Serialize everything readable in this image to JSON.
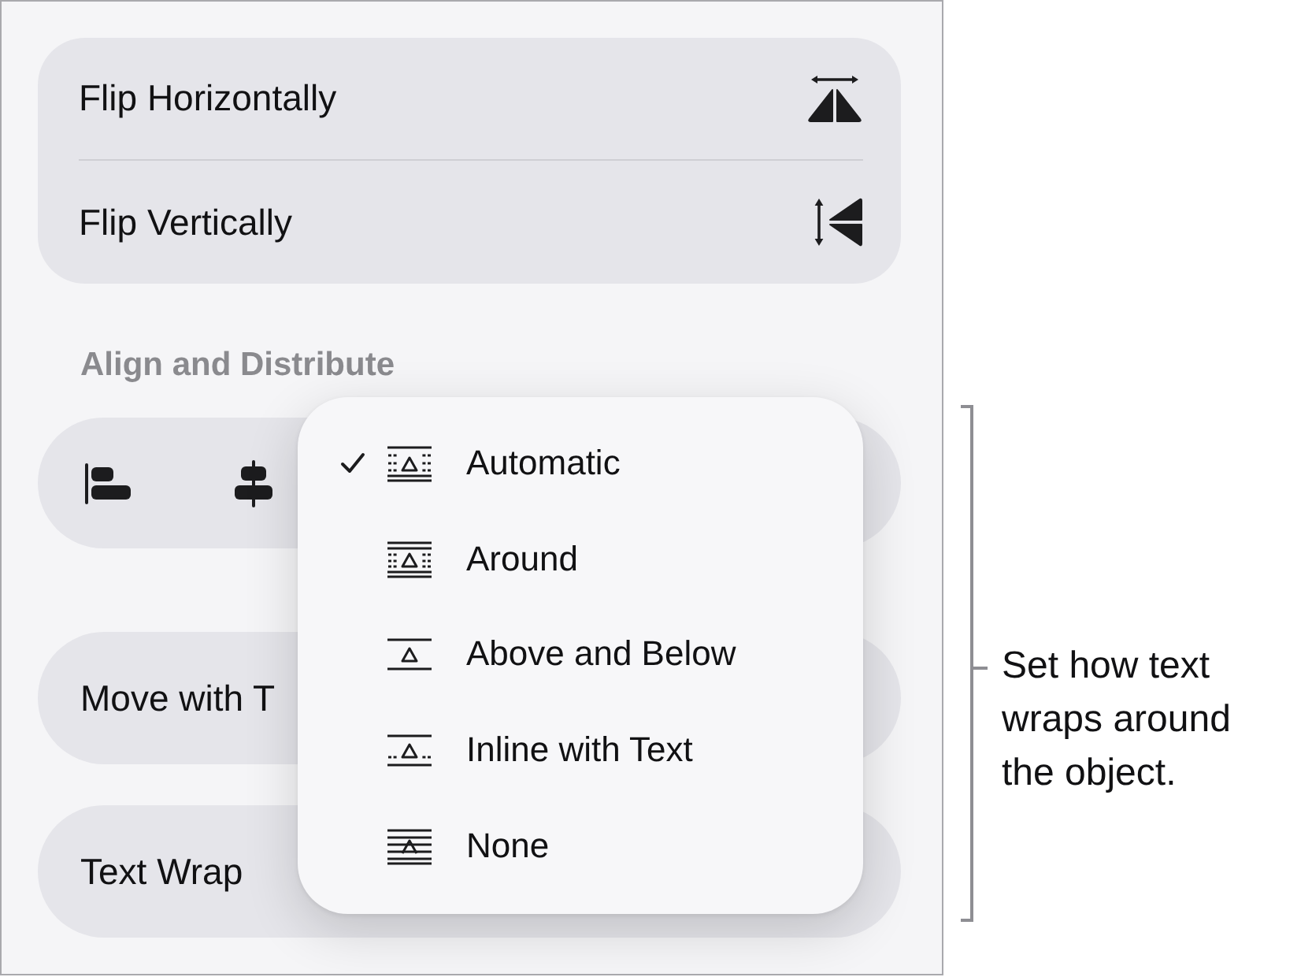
{
  "flip_options": [
    {
      "label": "Flip Horizontally"
    },
    {
      "label": "Flip Vertically"
    }
  ],
  "align_section": {
    "title": "Align and Distribute"
  },
  "settings": [
    {
      "label": "Move with T"
    },
    {
      "label": "Text Wrap"
    }
  ],
  "wrap_menu": {
    "items": [
      {
        "label": "Automatic",
        "selected": true
      },
      {
        "label": "Around",
        "selected": false
      },
      {
        "label": "Above and Below",
        "selected": false
      },
      {
        "label": "Inline with Text",
        "selected": false
      },
      {
        "label": "None",
        "selected": false
      }
    ]
  },
  "callout": {
    "text": "Set how text wraps around the object."
  }
}
